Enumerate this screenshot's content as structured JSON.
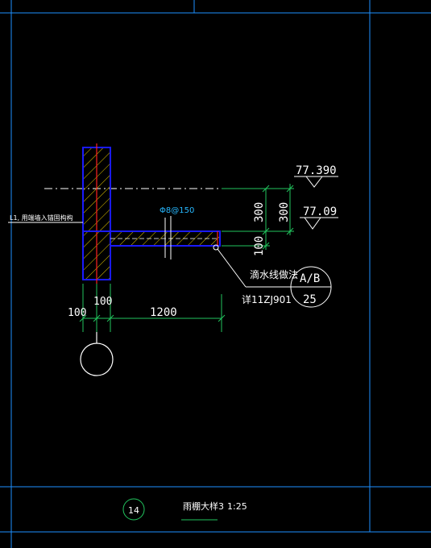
{
  "colors": {
    "background": "#000000",
    "frame": "#1e90ff",
    "wall": "#1a1aff",
    "hatch": "#e6c800",
    "section_line": "#ff2020",
    "dimension": "#22c55e",
    "text": "#ffffff",
    "callout_text": "#27b8ff"
  },
  "drawing": {
    "elevation_top": "77.390",
    "elevation_bottom": "77.09",
    "dim_300_a": "300",
    "dim_300_b": "300",
    "dim_100_vertical": "100",
    "rebar_callout": "Φ8@150",
    "wall_side_note": "L1, 用端墙入锚固构构",
    "drip_note": "滴水线做法",
    "detail_ref": "详11ZJ901",
    "detail_top": "A/B",
    "detail_bottom": "25",
    "dim_100_left": "100",
    "dim_100_right": "100",
    "dim_1200": "1200"
  },
  "title_block": {
    "number": "14",
    "name": "雨棚大样3",
    "scale": "1:25"
  }
}
